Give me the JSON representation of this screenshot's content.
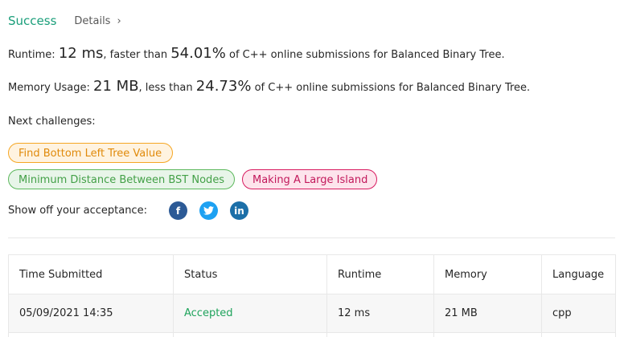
{
  "result": {
    "status": "Success",
    "details_label": "Details",
    "details_chevron": "›"
  },
  "runtime": {
    "label": "Runtime:",
    "value": "12 ms",
    "comparison": ", faster than",
    "percent": "54.01%",
    "suffix": "of C++ online submissions for Balanced Binary Tree."
  },
  "memory": {
    "label": "Memory Usage:",
    "value": "21 MB",
    "comparison": ", less than",
    "percent": "24.73%",
    "suffix": "of C++ online submissions for Balanced Binary Tree."
  },
  "next_challenges": {
    "label": "Next challenges:",
    "items": [
      {
        "title": "Find Bottom Left Tree Value",
        "difficulty": "medium",
        "color": "#f5a623"
      },
      {
        "title": "Minimum Distance Between BST Nodes",
        "difficulty": "easy",
        "color": "#5cb85c"
      },
      {
        "title": "Making A Large Island",
        "difficulty": "hard",
        "color": "#d81b60"
      }
    ]
  },
  "share": {
    "label": "Show off your acceptance:",
    "icons": [
      {
        "name": "facebook-icon",
        "glyph": "f",
        "color": "#2c5a96"
      },
      {
        "name": "twitter-icon",
        "glyph": "t",
        "color": "#1da1f2"
      },
      {
        "name": "linkedin-icon",
        "glyph": "in",
        "color": "#1c6fa8"
      }
    ]
  },
  "submissions": {
    "columns": [
      "Time Submitted",
      "Status",
      "Runtime",
      "Memory",
      "Language"
    ],
    "rows": [
      {
        "time": "05/09/2021 14:35",
        "status": "Accepted",
        "runtime": "12 ms",
        "memory": "21 MB",
        "language": "cpp"
      }
    ],
    "accepted_color": "#1fa35c"
  }
}
